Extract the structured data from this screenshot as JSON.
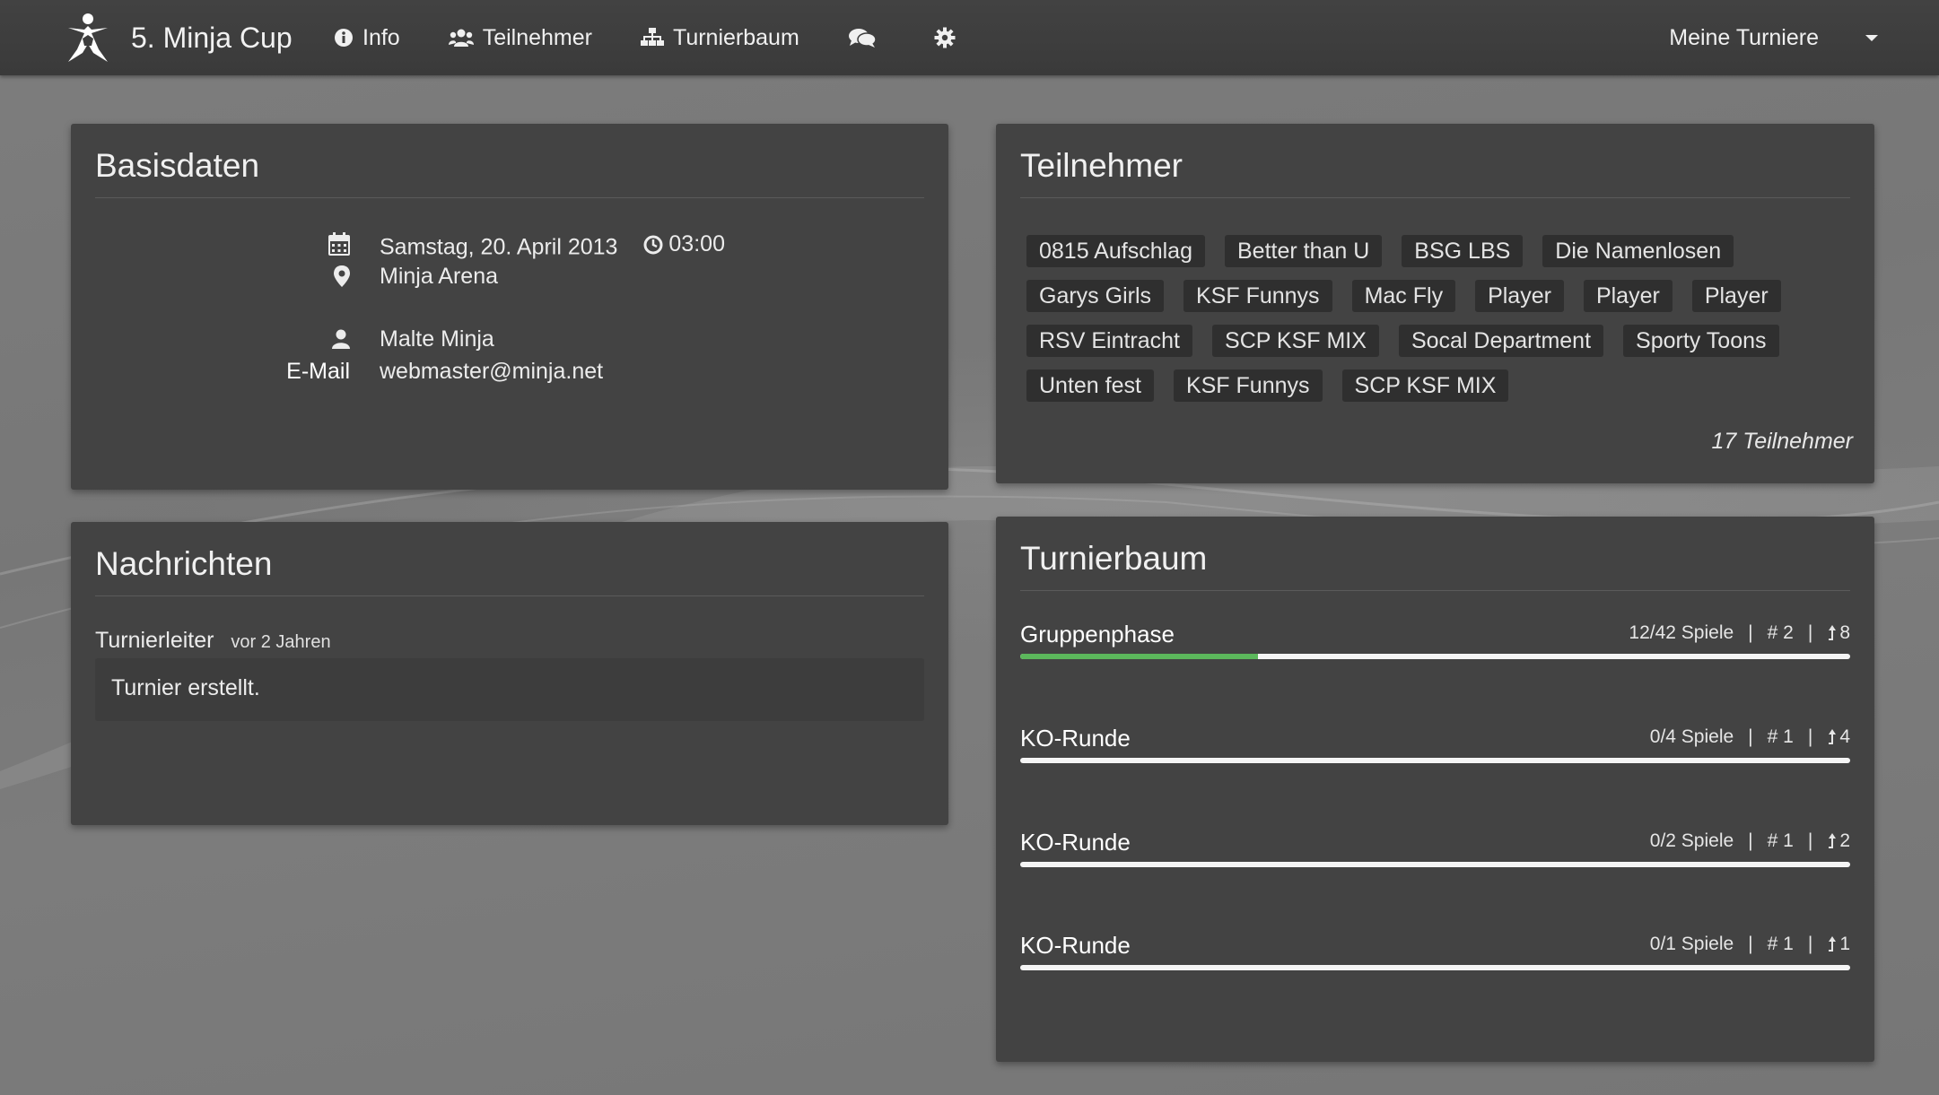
{
  "app": {
    "title": "5. Minja Cup"
  },
  "nav": {
    "info": "Info",
    "participants": "Teilnehmer",
    "bracket": "Turnierbaum",
    "my_tournaments": "Meine Turniere",
    "icons": [
      "info-icon",
      "users-icon",
      "sitemap-icon",
      "chat-icon",
      "gear-icon"
    ]
  },
  "basis": {
    "title": "Basisdaten",
    "date": "Samstag, 20. April 2013",
    "time": "03:00",
    "location": "Minja Arena",
    "organizer": "Malte Minja",
    "email_label": "E-Mail",
    "email": "webmaster@minja.net"
  },
  "participants": {
    "title": "Teilnehmer",
    "tags": [
      "0815 Aufschlag",
      "Better than U",
      "BSG LBS",
      "Die Namenlosen",
      "Garys Girls",
      "KSF Funnys",
      "Mac Fly",
      "Player",
      "Player",
      "Player",
      "RSV Eintracht",
      "SCP KSF MIX",
      "Socal Department",
      "Sporty Toons",
      "Unten fest",
      "KSF Funnys",
      "SCP KSF MIX"
    ],
    "count_label": "17 Teilnehmer"
  },
  "messages": {
    "title": "Nachrichten",
    "author": "Turnierleiter",
    "time": "vor 2 Jahren",
    "text": "Turnier erstellt."
  },
  "bracket": {
    "title": "Turnierbaum",
    "stages": [
      {
        "name": "Gruppenphase",
        "games": "12/42 Spiele",
        "groups": "# 2",
        "advance": "8",
        "progress": 0.286
      },
      {
        "name": "KO-Runde",
        "games": "0/4 Spiele",
        "groups": "# 1",
        "advance": "4",
        "progress": 0
      },
      {
        "name": "KO-Runde",
        "games": "0/2 Spiele",
        "groups": "# 1",
        "advance": "2",
        "progress": 0
      },
      {
        "name": "KO-Runde",
        "games": "0/1 Spiele",
        "groups": "# 1",
        "advance": "1",
        "progress": 0
      }
    ],
    "separator": "|"
  },
  "colors": {
    "progress_fill": "#5cb85c",
    "panel_bg": "#434343",
    "navbar_bg": "#3e3e3e"
  }
}
